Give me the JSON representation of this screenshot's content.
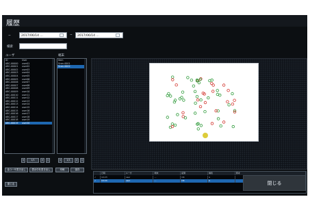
{
  "window": {
    "title": "履歴"
  },
  "period": {
    "from_label": "~",
    "from_value": "2017/06/14 …",
    "separator": "~",
    "to_value": "2017/06/14 …",
    "filter_label": "検索"
  },
  "left_panel": {
    "header": "ユーザ",
    "rows": [
      [
        "ID",
        "User"
      ],
      [
        "ABC-00000",
        "user01"
      ],
      [
        "ABC-00001",
        "user02"
      ],
      [
        "ABC-00002",
        "user03"
      ],
      [
        "ABC-00003",
        "user04"
      ],
      [
        "ABC-00004",
        "user05"
      ],
      [
        "ABC-00005",
        "user06"
      ],
      [
        "ABC-00006",
        "user07"
      ],
      [
        "ABC-00007",
        "user08"
      ],
      [
        "ABC-00008",
        "user09"
      ],
      [
        "ABC-00009",
        "user10"
      ],
      [
        "ABC-00010",
        "user11"
      ],
      [
        "ABC-00011",
        "user12"
      ],
      [
        "ABC-00012",
        "user13"
      ],
      [
        "ABC-00013",
        "user14"
      ],
      [
        "ABC-00014",
        "user15"
      ],
      [
        "ABC-00015",
        "user16"
      ],
      [
        "ABC-00016",
        "user17"
      ],
      [
        "ABC-00017",
        "user18"
      ],
      [
        "ABC-00018",
        "user19"
      ],
      [
        "ABC-00019",
        "user20"
      ]
    ],
    "selected_index": 20,
    "pager": {
      "prev": "<",
      "label": "1/1",
      "next": ">",
      "page": "1"
    }
  },
  "mid_panel": {
    "header": "端末",
    "rows": [
      [
        "Item"
      ],
      [
        "Scan-0001"
      ],
      [
        "Scan-0002"
      ]
    ],
    "selected_index": 2,
    "pager": {
      "prev": "<",
      "label": "1/1",
      "next": ">",
      "page": "1"
    }
  },
  "buttons": {
    "export": "全ユーザ書き出し",
    "export2": "表示中を書き出し",
    "print": "印刷",
    "save": "保存",
    "close": "閉じる",
    "ok": "閉じる"
  },
  "table": {
    "columns": [
      "",
      "日時",
      "ユーザ",
      "端末",
      "結果",
      "種別",
      "備考"
    ],
    "rows": [
      [
        "✓",
        "10:23",
        "user",
        "…",
        "OK",
        "A",
        ""
      ],
      [
        "✓",
        "10:24",
        "user",
        "…",
        "OK",
        "A",
        ""
      ]
    ],
    "selected_index": 1
  },
  "colors": {
    "accent": "#1e67b1",
    "background": "#0c0f12",
    "marks_green": "#2e9a3a",
    "marks_red": "#d2342d"
  }
}
